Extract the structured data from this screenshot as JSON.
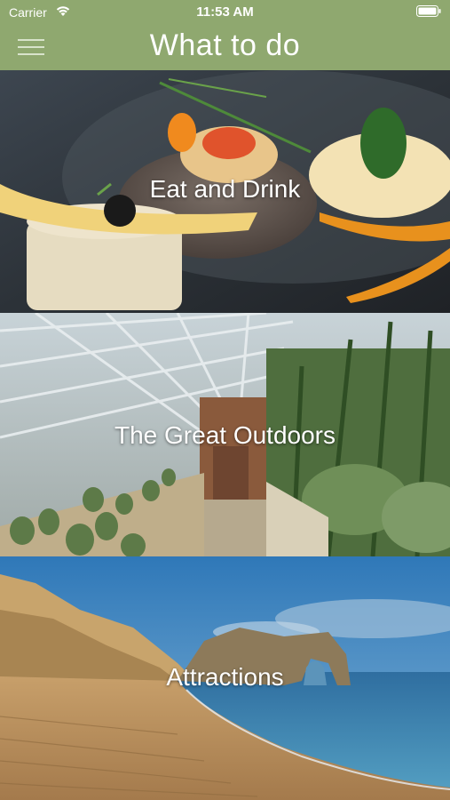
{
  "status_bar": {
    "carrier": "Carrier",
    "time": "11:53 AM",
    "wifi_icon": "wifi-icon",
    "battery_icon": "battery-icon"
  },
  "nav": {
    "title": "What to do",
    "menu_icon": "hamburger-menu-icon"
  },
  "categories": [
    {
      "label": "Eat and Drink",
      "image": "plated-gourmet-food-photo"
    },
    {
      "label": "The Great Outdoors",
      "image": "greenhouse-cactus-garden-photo"
    },
    {
      "label": "Attractions",
      "image": "coastal-rock-arch-beach-photo"
    }
  ],
  "colors": {
    "header_background": "#8fa86f",
    "text": "#ffffff"
  }
}
